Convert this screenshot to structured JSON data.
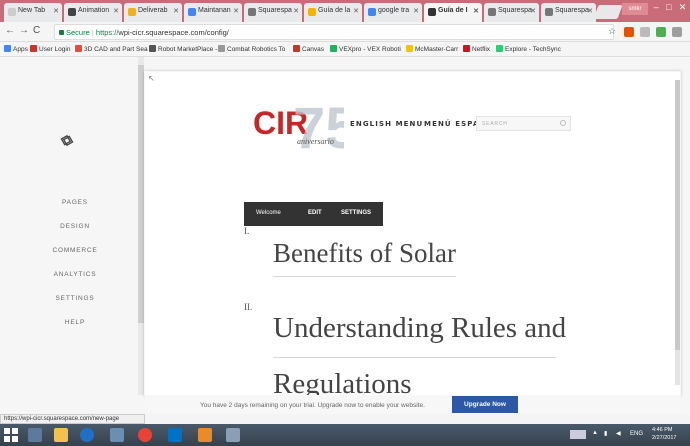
{
  "browser": {
    "tabs": [
      {
        "label": "New Tab",
        "color": "#cccccc"
      },
      {
        "label": "Animation",
        "color": "#444444"
      },
      {
        "label": "Deliverab",
        "color": "#f2b01e"
      },
      {
        "label": "Maintanan",
        "color": "#4285f4"
      },
      {
        "label": "Squarespa",
        "color": "#777777"
      },
      {
        "label": "Guía de la",
        "color": "#f4b400"
      },
      {
        "label": "google tra",
        "color": "#4285f4"
      },
      {
        "label": "Guía de I",
        "color": "#333333",
        "active": true
      },
      {
        "label": "Squarespa",
        "color": "#777777"
      },
      {
        "label": "Squarespa",
        "color": "#777777"
      }
    ],
    "user_label": "smkr",
    "secure_label": "Secure",
    "url_prefix": "https://",
    "url_rest": "wpi-cicr.squarespace.com/config/",
    "bookmarks": [
      {
        "label": "Apps",
        "color": "#4285f4"
      },
      {
        "label": "User Login",
        "color": "#c0392b"
      },
      {
        "label": "3D CAD and Part Sea",
        "color": "#e74c3c"
      },
      {
        "label": "Robot MarketPlace -",
        "color": "#555555"
      },
      {
        "label": "Combat Robotics To",
        "color": "#999999"
      },
      {
        "label": "Canvas",
        "color": "#c0392b"
      },
      {
        "label": "VEXpro - VEX Roboti",
        "color": "#27ae60"
      },
      {
        "label": "McMaster-Carr",
        "color": "#f1c40f"
      },
      {
        "label": "Netflix",
        "color": "#e50914"
      },
      {
        "label": "Explore - TechSync",
        "color": "#2ecc71"
      }
    ]
  },
  "sidebar": {
    "items": [
      {
        "label": "PAGES"
      },
      {
        "label": "DESIGN"
      },
      {
        "label": "COMMERCE"
      },
      {
        "label": "ANALYTICS"
      },
      {
        "label": "SETTINGS"
      },
      {
        "label": "HELP"
      }
    ]
  },
  "site": {
    "logo_letters": "CIR",
    "logo_number": "75",
    "logo_sub": "aniversario",
    "nav": {
      "english": "ENGLISH MENU",
      "espanol": "MENÚ ESPAÑOL"
    },
    "search_placeholder": "SEARCH",
    "edit_bar": {
      "welcome": "Welcome",
      "edit": "EDIT",
      "settings": "SETTINGS"
    },
    "sections": [
      {
        "numeral": "I.",
        "heading": "Benefits of Solar"
      },
      {
        "numeral": "II.",
        "heading": "Understanding Rules and"
      },
      {
        "numeral": "",
        "heading": "Regulations"
      }
    ]
  },
  "trial": {
    "message": "You have 2 days remaining on your trial. Upgrade now to enable your website.",
    "button": "Upgrade Now"
  },
  "status_url": "https://wpi-cicr.squarespace.com/new-page",
  "taskbar": {
    "lang": "ENG",
    "time": "4:46 PM",
    "date": "2/27/2017"
  },
  "colors": {
    "accent": "#2c58a5",
    "logo_red": "#c62828",
    "logo_blue": "#1e3a6e"
  }
}
